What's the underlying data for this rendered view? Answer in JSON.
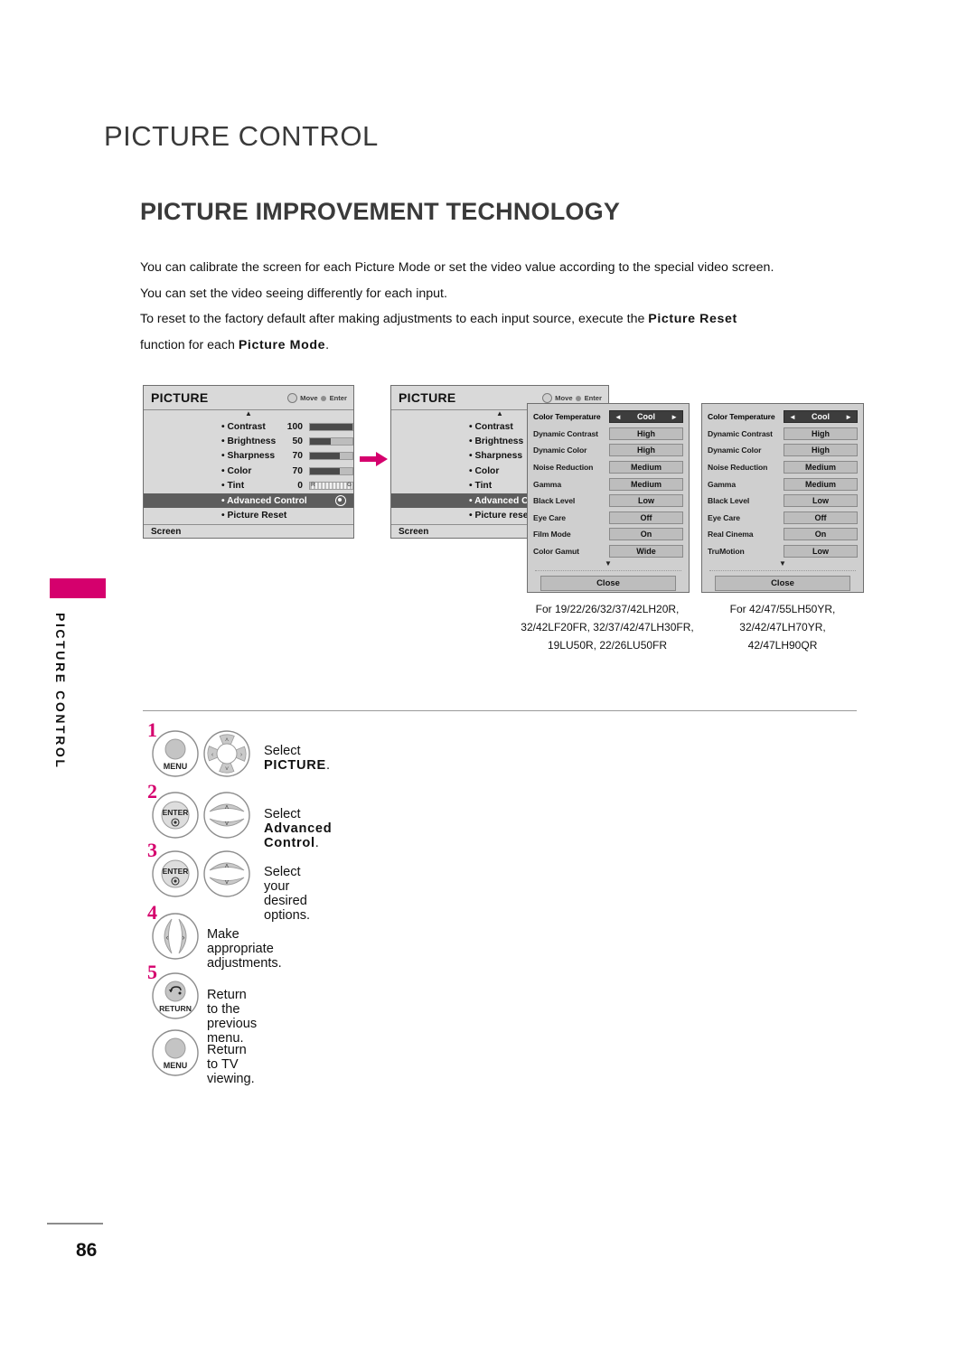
{
  "page": {
    "title": "PICTURE CONTROL",
    "section_title": "PICTURE IMPROVEMENT TECHNOLOGY",
    "side_tab_label": "PICTURE CONTROL",
    "page_number": "86",
    "accent_color": "#d5006d"
  },
  "intro": {
    "line1": "You can calibrate the screen for each Picture Mode or set the video value according to the special video screen.",
    "line2": "You can set the video seeing differently for each input.",
    "line3_a": "To reset to the factory default after making adjustments to each input source, execute the ",
    "line3_b": "Picture Reset",
    "line4_a": "function for each ",
    "line4_b": "Picture Mode",
    "line4_c": "."
  },
  "osd1": {
    "title": "PICTURE",
    "hint_move": "Move",
    "hint_enter": "Enter",
    "footer": "Screen",
    "up_caret": "▲",
    "rows": [
      {
        "label": "• Contrast",
        "value": "100",
        "fill": 100
      },
      {
        "label": "• Brightness",
        "value": "50",
        "fill": 50
      },
      {
        "label": "• Sharpness",
        "value": "70",
        "fill": 70
      },
      {
        "label": "• Color",
        "value": "70",
        "fill": 70
      },
      {
        "label": "• Tint",
        "value": "0",
        "fill": 0,
        "tint": true
      }
    ],
    "highlight_row": "• Advanced Control",
    "last_row": "• Picture Reset"
  },
  "osd2": {
    "title": "PICTURE",
    "hint_move": "Move",
    "hint_enter": "Enter",
    "footer": "Screen",
    "up_caret": "▲",
    "rows": [
      {
        "label": "• Contrast"
      },
      {
        "label": "• Brightness"
      },
      {
        "label": "• Sharpness"
      },
      {
        "label": "• Color"
      },
      {
        "label": "• Tint"
      }
    ],
    "highlight_row": "• Advanced Co",
    "last_row": "• Picture reset"
  },
  "adv_left": {
    "rows": [
      {
        "key": "Color Temperature",
        "value": "Cool",
        "selected": true
      },
      {
        "key": "Dynamic Contrast",
        "value": "High",
        "selected": false
      },
      {
        "key": "Dynamic Color",
        "value": "High",
        "selected": false
      },
      {
        "key": "Noise Reduction",
        "value": "Medium",
        "selected": false
      },
      {
        "key": "Gamma",
        "value": "Medium",
        "selected": false
      },
      {
        "key": "Black Level",
        "value": "Low",
        "selected": false
      },
      {
        "key": "Eye Care",
        "value": "Off",
        "selected": false
      },
      {
        "key": "Film Mode",
        "value": "On",
        "selected": false
      },
      {
        "key": "Color Gamut",
        "value": "Wide",
        "selected": false
      }
    ],
    "down_caret": "▼",
    "close_label": "Close",
    "left_arrow": "◄",
    "right_arrow": "►"
  },
  "adv_right": {
    "rows": [
      {
        "key": "Color Temperature",
        "value": "Cool",
        "selected": true
      },
      {
        "key": "Dynamic Contrast",
        "value": "High",
        "selected": false
      },
      {
        "key": "Dynamic Color",
        "value": "High",
        "selected": false
      },
      {
        "key": "Noise Reduction",
        "value": "Medium",
        "selected": false
      },
      {
        "key": "Gamma",
        "value": "Medium",
        "selected": false
      },
      {
        "key": "Black Level",
        "value": "Low",
        "selected": false
      },
      {
        "key": "Eye Care",
        "value": "Off",
        "selected": false
      },
      {
        "key": "Real Cinema",
        "value": "On",
        "selected": false
      },
      {
        "key": "TruMotion",
        "value": "Low",
        "selected": false
      }
    ],
    "down_caret": "▼",
    "close_label": "Close",
    "left_arrow": "◄",
    "right_arrow": "►"
  },
  "captions": {
    "left": "For 19/22/26/32/37/42LH20R, 32/42LF20FR, 32/37/42/47LH30FR, 19LU50R, 22/26LU50FR",
    "left_l1": "For 19/22/26/32/37/42LH20R,",
    "left_l2": "32/42LF20FR, 32/37/42/47LH30FR,",
    "left_l3": "19LU50R, 22/26LU50FR",
    "right_l1": "For 42/47/55LH50YR,",
    "right_l2": "32/42/47LH70YR,",
    "right_l3": "42/47LH90QR"
  },
  "steps": [
    {
      "num": "1",
      "text_a": "Select ",
      "text_b": "PICTURE",
      "text_c": ".",
      "buttons": [
        "MENU",
        "dpad"
      ]
    },
    {
      "num": "2",
      "text_a": "Select ",
      "text_b": "Advanced Control",
      "text_c": ".",
      "buttons": [
        "ENTER",
        "updown"
      ]
    },
    {
      "num": "3",
      "text_a": "Select your desired options.",
      "text_b": "",
      "text_c": "",
      "buttons": [
        "ENTER",
        "updown"
      ]
    },
    {
      "num": "4",
      "text_a": "Make appropriate adjustments.",
      "text_b": "",
      "text_c": "",
      "buttons": [
        "leftright"
      ]
    },
    {
      "num": "5",
      "text_a": "Return to the previous menu.",
      "text_b": "",
      "text_c": "",
      "buttons": [
        "RETURN"
      ]
    },
    {
      "num": "",
      "text_a": "Return to TV viewing.",
      "text_b": "",
      "text_c": "",
      "buttons": [
        "MENU"
      ]
    }
  ],
  "button_labels": {
    "menu": "MENU",
    "enter": "ENTER",
    "return": "RETURN"
  }
}
